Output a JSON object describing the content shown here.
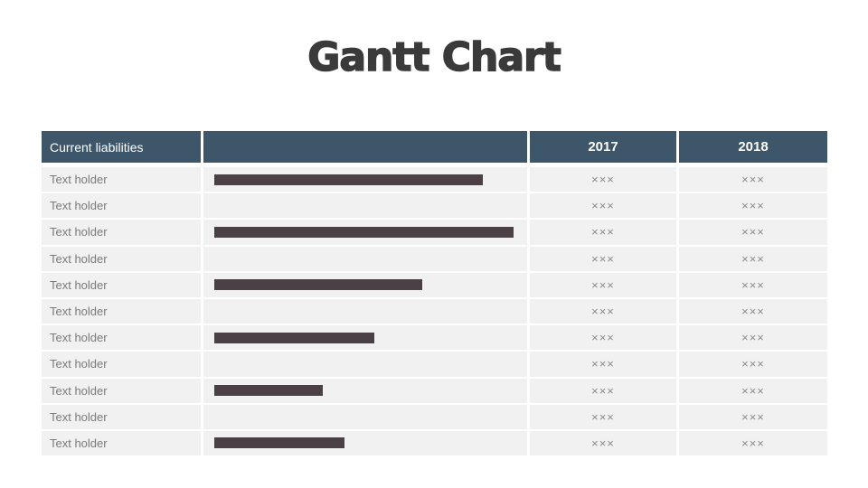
{
  "title": "Gantt Chart",
  "chart_data": {
    "type": "bar",
    "orientation": "horizontal",
    "title": "Gantt Chart",
    "columns": [
      "Current liabilities",
      "",
      "2017",
      "2018"
    ],
    "rows": [
      {
        "label": "Text holder",
        "bar": 0.89,
        "v2017": "×××",
        "v2018": "×××"
      },
      {
        "label": "Text holder",
        "bar": null,
        "v2017": "×××",
        "v2018": "×××"
      },
      {
        "label": "Text holder",
        "bar": 0.99,
        "v2017": "×××",
        "v2018": "×××"
      },
      {
        "label": "Text holder",
        "bar": null,
        "v2017": "×××",
        "v2018": "×××"
      },
      {
        "label": "Text holder",
        "bar": 0.69,
        "v2017": "×××",
        "v2018": "×××"
      },
      {
        "label": "Text holder",
        "bar": null,
        "v2017": "×××",
        "v2018": "×××"
      },
      {
        "label": "Text holder",
        "bar": 0.53,
        "v2017": "×××",
        "v2018": "×××"
      },
      {
        "label": "Text holder",
        "bar": null,
        "v2017": "×××",
        "v2018": "×××"
      },
      {
        "label": "Text holder",
        "bar": 0.36,
        "v2017": "×××",
        "v2018": "×××"
      },
      {
        "label": "Text holder",
        "bar": null,
        "v2017": "×××",
        "v2018": "×××"
      },
      {
        "label": "Text holder",
        "bar": 0.43,
        "v2017": "×××",
        "v2018": "×××"
      }
    ],
    "bar_scale": "fraction of timeline column width",
    "colors": {
      "header": "#3d566a",
      "bar": "#4b4046",
      "row": "#f1f1f1"
    }
  }
}
